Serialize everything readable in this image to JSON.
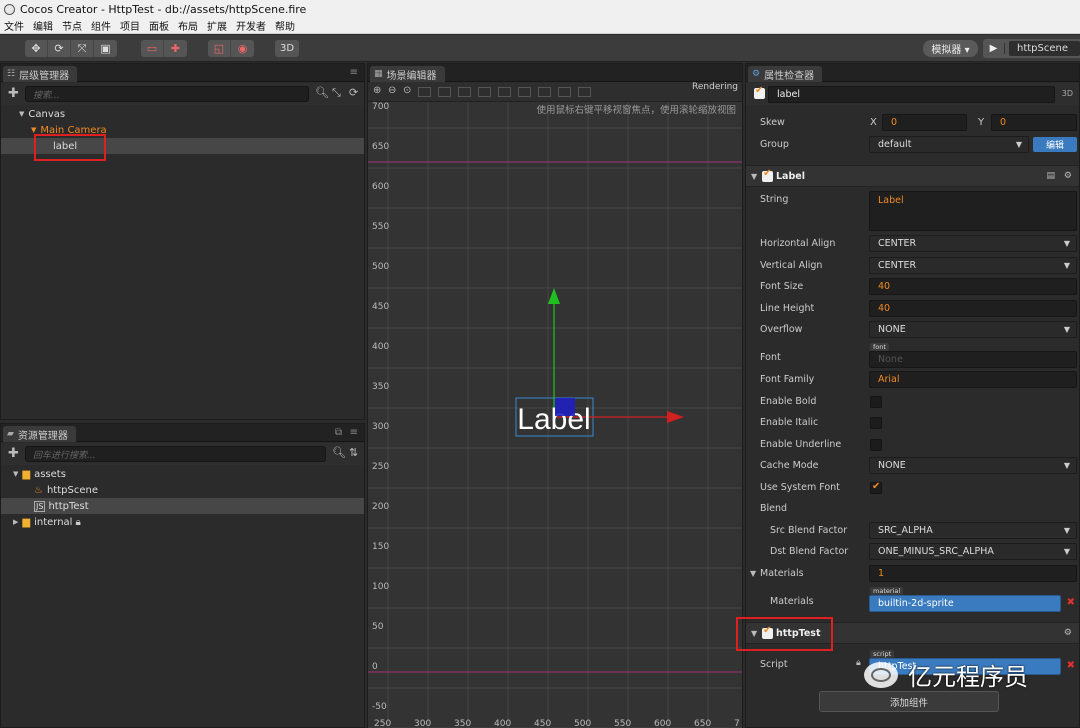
{
  "window": {
    "title": "Cocos Creator - HttpTest - db://assets/httpScene.fire"
  },
  "menu": [
    "文件",
    "编辑",
    "节点",
    "组件",
    "项目",
    "面板",
    "布局",
    "扩展",
    "开发者",
    "帮助"
  ],
  "toolbar": {
    "btn_3d": "3D",
    "simulator": "模拟器 ▾",
    "scene_select": "httpScene"
  },
  "hierarchy": {
    "tab": "层级管理器",
    "search_placeholder": "搜索...",
    "nodes": [
      {
        "label": "Canvas",
        "depth": 0,
        "expanded": true
      },
      {
        "label": "Main Camera",
        "depth": 1,
        "expanded": true
      },
      {
        "label": "label",
        "depth": 2,
        "selected": true
      }
    ]
  },
  "assets": {
    "tab": "资源管理器",
    "search_placeholder": "回车进行搜索...",
    "items": [
      {
        "label": "assets",
        "depth": 0,
        "expanded": true
      },
      {
        "label": "httpScene",
        "depth": 1,
        "icon": "fire-icon"
      },
      {
        "label": "httpTest",
        "depth": 1,
        "icon": "js-icon",
        "selected": true
      },
      {
        "label": "internal",
        "depth": 0,
        "locked": true
      }
    ]
  },
  "scene": {
    "tab": "场景编辑器",
    "hint": "使用鼠标右键平移视窗焦点，使用滚轮缩放视图",
    "rendering": "Rendering",
    "y_ticks": [
      "700",
      "650",
      "600",
      "550",
      "500",
      "450",
      "400",
      "350",
      "300",
      "250",
      "200",
      "150",
      "100",
      "50",
      "0",
      "-50"
    ],
    "x_ticks": [
      "250",
      "300",
      "350",
      "400",
      "450",
      "500",
      "550",
      "600",
      "650",
      "7"
    ],
    "label_text": "Label"
  },
  "inspector": {
    "tab": "属性检查器",
    "node_name": "label",
    "btn_3d": "3D",
    "skew": {
      "label": "Skew",
      "x_label": "X",
      "x": "0",
      "y_label": "Y",
      "y": "0"
    },
    "group": {
      "label": "Group",
      "value": "default",
      "edit": "编辑"
    },
    "label_component": {
      "title": "Label",
      "string_label": "String",
      "string_value": "Label",
      "halign_label": "Horizontal Align",
      "halign": "CENTER",
      "valign_label": "Vertical Align",
      "valign": "CENTER",
      "font_size_label": "Font Size",
      "font_size": "40",
      "line_height_label": "Line Height",
      "line_height": "40",
      "overflow_label": "Overflow",
      "overflow": "NONE",
      "font_label": "Font",
      "font_tag": "font",
      "font_value": "None",
      "font_family_label": "Font Family",
      "font_family": "Arial",
      "bold_label": "Enable Bold",
      "italic_label": "Enable Italic",
      "underline_label": "Enable Underline",
      "cache_mode_label": "Cache Mode",
      "cache_mode": "NONE",
      "sys_font_label": "Use System Font",
      "blend_label": "Blend",
      "src_blend_label": "Src Blend Factor",
      "src_blend": "SRC_ALPHA",
      "dst_blend_label": "Dst Blend Factor",
      "dst_blend": "ONE_MINUS_SRC_ALPHA",
      "materials_label": "Materials",
      "materials_count": "1",
      "materials_item_label": "Materials",
      "material_tag": "material",
      "material_value": "builtin-2d-sprite"
    },
    "script_component": {
      "title": "httpTest",
      "script_label": "Script",
      "script_tag": "script",
      "script_value": "httpTest"
    },
    "add_component": "添加组件"
  },
  "watermark": {
    "text": "亿元程序员"
  },
  "colors": {
    "accent_orange": "#f08a24",
    "highlight_red": "#e02020",
    "selection_blue": "#3a7bbf"
  }
}
